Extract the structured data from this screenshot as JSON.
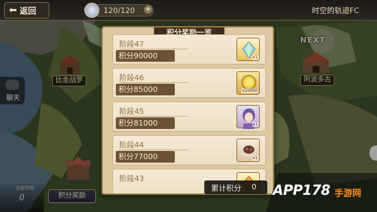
{
  "topbar": {
    "back_label": "返回",
    "stamina": "120/120",
    "stamina_plus": "+",
    "event_title": "时空的轨迹FC"
  },
  "map": {
    "chat_label": "聊天",
    "location_left": "比金战罗",
    "location_right": "阿波多古",
    "next_label": "NEXT",
    "bottom_caption": "当前持有",
    "bottom_count": "0",
    "points_button": "积分奖励"
  },
  "modal": {
    "title": "积分奖励一览",
    "rows": [
      {
        "stage": "阶段47",
        "points": "积分90000",
        "reward_icon": "gem-icon",
        "badge": "x1"
      },
      {
        "stage": "阶段46",
        "points": "积分85000",
        "reward_icon": "mira-coin-icon",
        "badge": "x10000"
      },
      {
        "stage": "阶段45",
        "points": "积分81000",
        "reward_icon": "character-portrait-icon",
        "badge": "x1"
      },
      {
        "stage": "阶段44",
        "points": "积分77000",
        "reward_icon": "food-icon",
        "badge": "x1"
      },
      {
        "stage": "阶段43",
        "points": "",
        "reward_icon": "gem-icon",
        "badge": ""
      }
    ],
    "total_label": "累计积分",
    "total_value": "0"
  },
  "watermark": {
    "text": "APP178",
    "sub": "手游网"
  }
}
